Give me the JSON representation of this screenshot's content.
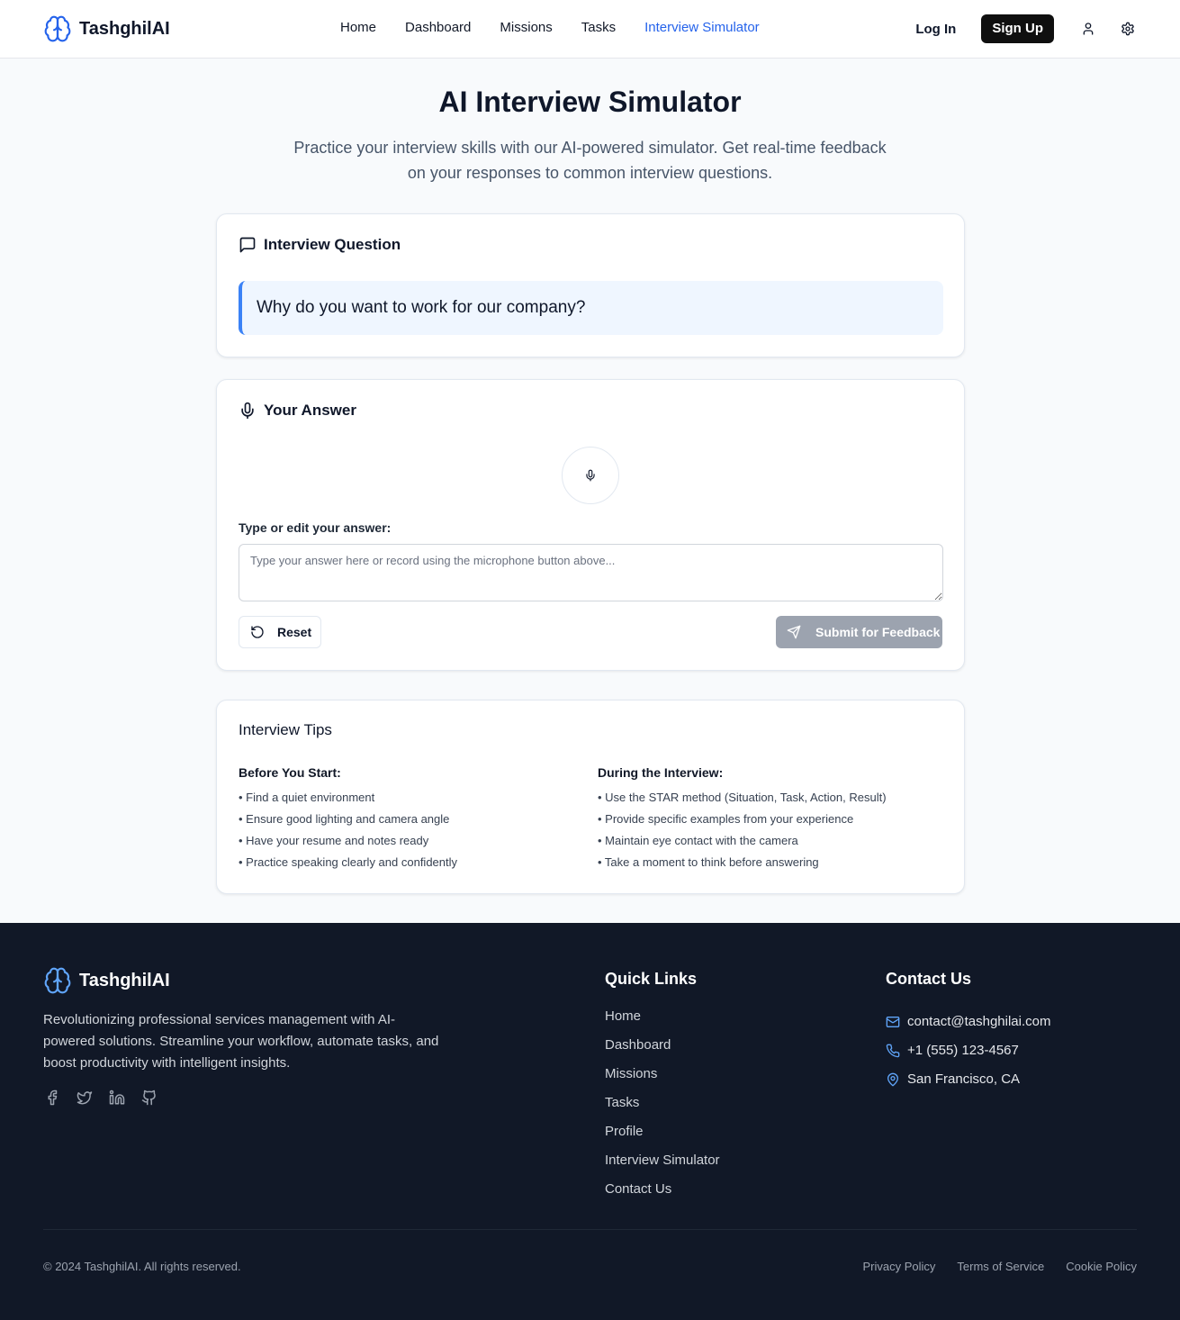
{
  "brand": {
    "name": "TashghilAI",
    "accent": "#2563eb",
    "icon": "brain-icon"
  },
  "nav": {
    "items": [
      {
        "label": "Home",
        "active": false
      },
      {
        "label": "Dashboard",
        "active": false
      },
      {
        "label": "Missions",
        "active": false
      },
      {
        "label": "Tasks",
        "active": false
      },
      {
        "label": "Interview Simulator",
        "active": true
      }
    ],
    "login_label": "Log In",
    "signup_label": "Sign Up",
    "user_icon": "user-icon",
    "settings_icon": "gear-icon"
  },
  "hero": {
    "title": "AI Interview Simulator",
    "subtitle": "Practice your interview skills with our AI-powered simulator. Get real-time feedback on your responses to common interview questions."
  },
  "question_card": {
    "title": "Interview Question",
    "icon": "message-square-icon",
    "question": "Why do you want to work for our company?"
  },
  "answer_card": {
    "title": "Your Answer",
    "icon": "mic-icon",
    "label": "Type or edit your answer:",
    "placeholder": "Type your answer here or record using the microphone button above...",
    "value": "",
    "reset_label": "Reset",
    "submit_label": "Submit for Feedback"
  },
  "tips": {
    "title": "Interview Tips",
    "before": {
      "heading": "Before You Start:",
      "items": [
        "• Find a quiet environment",
        "• Ensure good lighting and camera angle",
        "• Have your resume and notes ready",
        "• Practice speaking clearly and confidently"
      ]
    },
    "during": {
      "heading": "During the Interview:",
      "items": [
        "• Use the STAR method (Situation, Task, Action, Result)",
        "• Provide specific examples from your experience",
        "• Maintain eye contact with the camera",
        "• Take a moment to think before answering"
      ]
    }
  },
  "footer": {
    "brand": "TashghilAI",
    "description": "Revolutionizing professional services management with AI-powered solutions. Streamline your workflow, automate tasks, and boost productivity with intelligent insights.",
    "social": [
      "facebook-icon",
      "twitter-icon",
      "linkedin-icon",
      "github-icon"
    ],
    "quick_links_title": "Quick Links",
    "quick_links": [
      "Home",
      "Dashboard",
      "Missions",
      "Tasks",
      "Profile",
      "Interview Simulator",
      "Contact Us"
    ],
    "contact_title": "Contact Us",
    "contact": {
      "email": "contact@tashghilai.com",
      "phone": "+1 (555) 123-4567",
      "location": "San Francisco, CA"
    },
    "copyright": "© 2024 TashghilAI. All rights reserved.",
    "legal": [
      "Privacy Policy",
      "Terms of Service",
      "Cookie Policy"
    ]
  }
}
